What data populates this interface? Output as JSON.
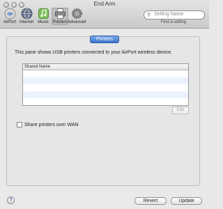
{
  "window": {
    "title": "End Arm"
  },
  "toolbar": {
    "items": [
      {
        "label": "AirPort",
        "icon": "airport-icon"
      },
      {
        "label": "Internet",
        "icon": "globe-icon"
      },
      {
        "label": "Music",
        "icon": "music-icon"
      },
      {
        "label": "Printers",
        "icon": "printer-icon",
        "selected": true
      },
      {
        "label": "Advanced",
        "icon": "gear-icon"
      }
    ]
  },
  "search": {
    "placeholder": "Setting Name",
    "hint": "Find a setting"
  },
  "tabs": [
    {
      "label": "Printers",
      "selected": true
    }
  ],
  "main": {
    "description": "This pane shows USB printers connected to your AirPort wireless device.",
    "table": {
      "columns": [
        "Shared Name"
      ],
      "rows": []
    },
    "edit_label": "Edit",
    "share_checkbox": {
      "label": "Share printers over WAN",
      "checked": false
    }
  },
  "footer": {
    "help_label": "?",
    "revert_label": "Revert",
    "update_label": "Update"
  },
  "colors": {
    "accent": "#3c73c9",
    "row_alt": "#edf3fe"
  }
}
